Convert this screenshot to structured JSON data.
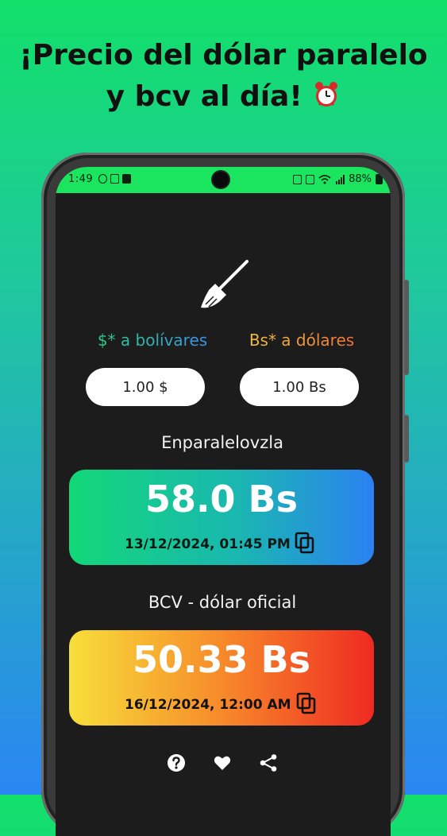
{
  "headline": {
    "line1": "¡Precio del dólar paralelo",
    "line2": "y bcv al día!",
    "emoji_icon": "alarm-clock-icon"
  },
  "status_bar": {
    "time": "1:49",
    "battery": "88%"
  },
  "converter": {
    "left_label": "$* a bolívares",
    "right_label": "Bs* a dólares",
    "left_input_value": "1.00 $",
    "right_input_value": "1.00 Bs"
  },
  "paralelo": {
    "title": "Enparalelovzla",
    "value": "58.0 Bs",
    "timestamp": "13/12/2024, 01:45 PM"
  },
  "bcv": {
    "title": "BCV - dólar oficial",
    "value": "50.33 Bs",
    "timestamp": "16/12/2024, 12:00 AM"
  },
  "colors": {
    "status_bar": "#1be45e",
    "screen_bg": "#1c1c1d",
    "green_card_start": "#12d878",
    "green_card_end": "#2b82f2",
    "warm_card_start": "#f7df3a",
    "warm_card_end": "#ef2a22"
  }
}
